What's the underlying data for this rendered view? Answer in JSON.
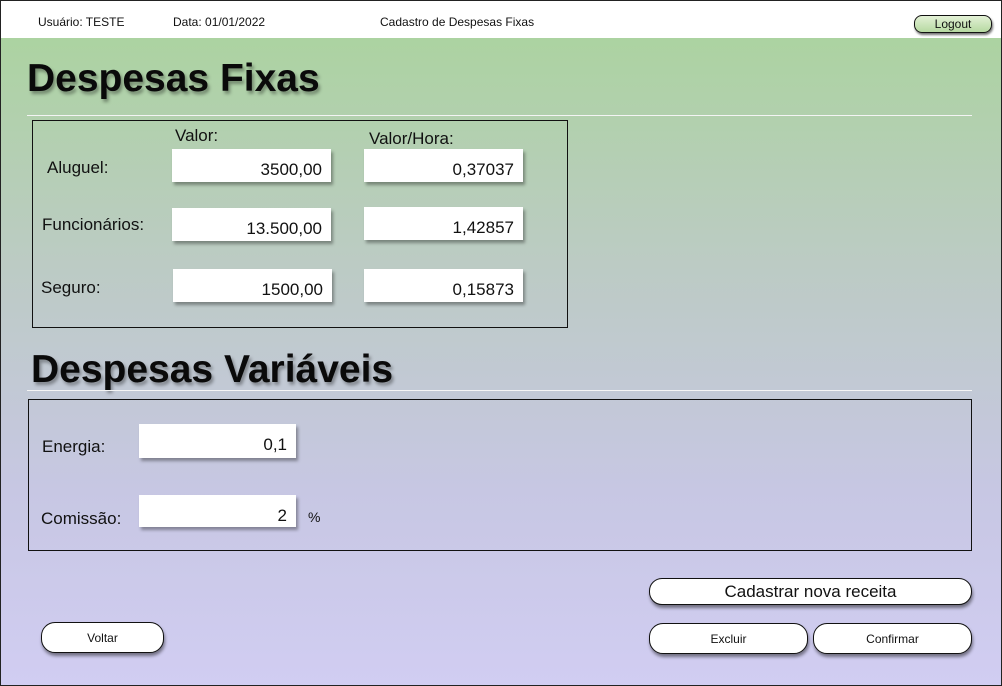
{
  "header": {
    "user": "Usuário: TESTE",
    "date": "Data: 01/01/2022",
    "title": "Cadastro de  Despesas Fixas",
    "logout_label": "Logout"
  },
  "fixed": {
    "heading": "Despesas Fixas",
    "col_value": "Valor:",
    "col_hourly": "Valor/Hora:",
    "rows": [
      {
        "label": "Aluguel:",
        "value": "3500,00",
        "hourly": "0,37037"
      },
      {
        "label": "Funcionários:",
        "value": "13.500,00",
        "hourly": "1,42857"
      },
      {
        "label": "Seguro:",
        "value": "1500,00",
        "hourly": "0,15873"
      }
    ]
  },
  "variable": {
    "heading": "Despesas Variáveis",
    "energy_label": "Energia:",
    "energy_value": "0,1",
    "commission_label": "Comissão:",
    "commission_value": "2",
    "commission_unit": "%"
  },
  "actions": {
    "new_recipe": "Cadastrar nova receita",
    "back": "Voltar",
    "delete": "Excluir",
    "confirm": "Confirmar"
  }
}
